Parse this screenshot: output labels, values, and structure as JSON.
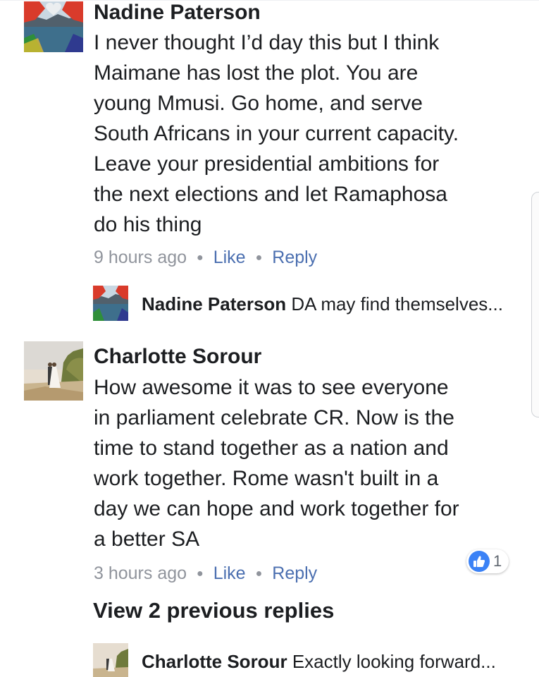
{
  "comments": [
    {
      "author": "Nadine Paterson",
      "text": "I never thought I’d day this but I think\nMaimane has lost the plot. You are\nyoung Mmusi. Go home, and serve\nSouth Africans in your current capacity.\nLeave your presidential ambitions for\nthe next elections and let Ramaphosa\ndo his thing",
      "time": "9 hours ago",
      "like_label": "Like",
      "reply_label": "Reply",
      "reply_preview": {
        "author": "Nadine Paterson",
        "text": "DA may find themselves..."
      }
    },
    {
      "author": "Charlotte Sorour",
      "text": "How awesome it was to see everyone\nin parliament celebrate CR.  Now is the\ntime to stand together as a nation and\nwork together. Rome wasn't built in a\nday we can hope and work together  for\na better SA",
      "time": "3 hours ago",
      "like_label": "Like",
      "reply_label": "Reply",
      "reactions": {
        "icon": "thumbs-up-icon",
        "count": "1"
      },
      "view_previous": "View 2 previous replies",
      "reply_preview": {
        "author": "Charlotte Sorour",
        "text": "Exactly looking forward..."
      }
    }
  ],
  "colors": {
    "text": "#1c1e21",
    "meta": "#90949c",
    "link": "#4b6fb0",
    "like_badge": "#3b82f6"
  }
}
